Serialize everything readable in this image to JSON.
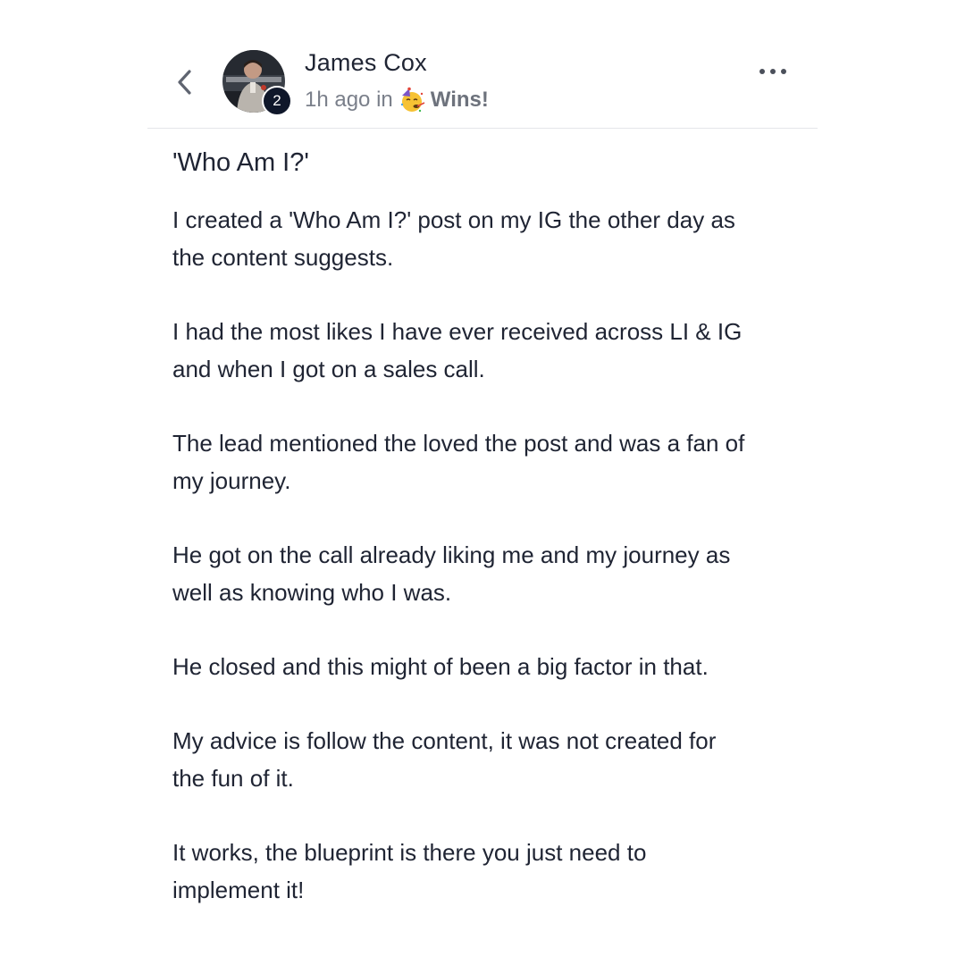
{
  "header": {
    "author_name": "James Cox",
    "level": "2",
    "time_ago": "1h ago in",
    "category": "Wins!",
    "category_icon": "partying-face-emoji-icon",
    "back_icon": "chevron-left-icon",
    "more_icon": "more-horizontal-icon"
  },
  "post": {
    "title": "'Who Am I?'",
    "paragraphs": [
      "I created a 'Who Am I?' post on my IG the other day as\nthe content suggests.",
      "I had the most likes I have ever received across LI & IG\nand when I got on a sales call.",
      "The lead mentioned the loved the post and was a fan of\nmy journey.",
      "He got on the call already liking me and my journey as\nwell as knowing who I was.",
      "He closed and this might of been a big factor in that.",
      "My advice is follow the content, it was not created for\nthe fun of it.",
      "It works, the blueprint is there you just need to\nimplement it!"
    ]
  },
  "colors": {
    "text": "#1f2433",
    "meta": "#7a7f8a",
    "badge": "#0f172a",
    "divider": "#e4e5e9"
  }
}
